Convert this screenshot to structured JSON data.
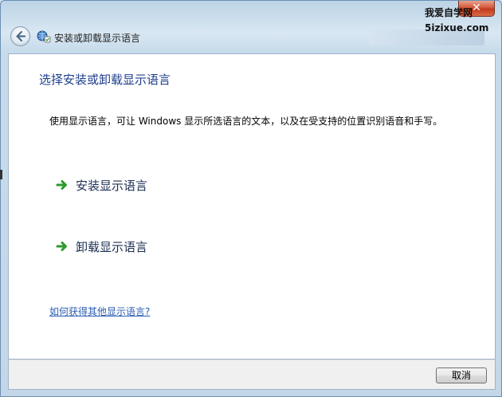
{
  "window": {
    "breadcrumb_title": "安装或卸载显示语言",
    "close_label": "✕"
  },
  "watermark": {
    "line1": "我爱自学网",
    "line2": "5izixue.com"
  },
  "main": {
    "title": "选择安装或卸载显示语言",
    "description": "使用显示语言，可让 Windows 显示所选语言的文本，以及在受支持的位置识别语音和手写。",
    "tasks": [
      {
        "label": "安装显示语言",
        "icon": "green-arrow-icon"
      },
      {
        "label": "卸载显示语言",
        "icon": "green-arrow-icon"
      }
    ],
    "help_link": "如何获得其他显示语言?"
  },
  "footer": {
    "cancel_label": "取消"
  },
  "colors": {
    "title_blue": "#1f3f8c",
    "link_blue": "#2a5db0",
    "arrow_green": "#2e9a2e"
  }
}
